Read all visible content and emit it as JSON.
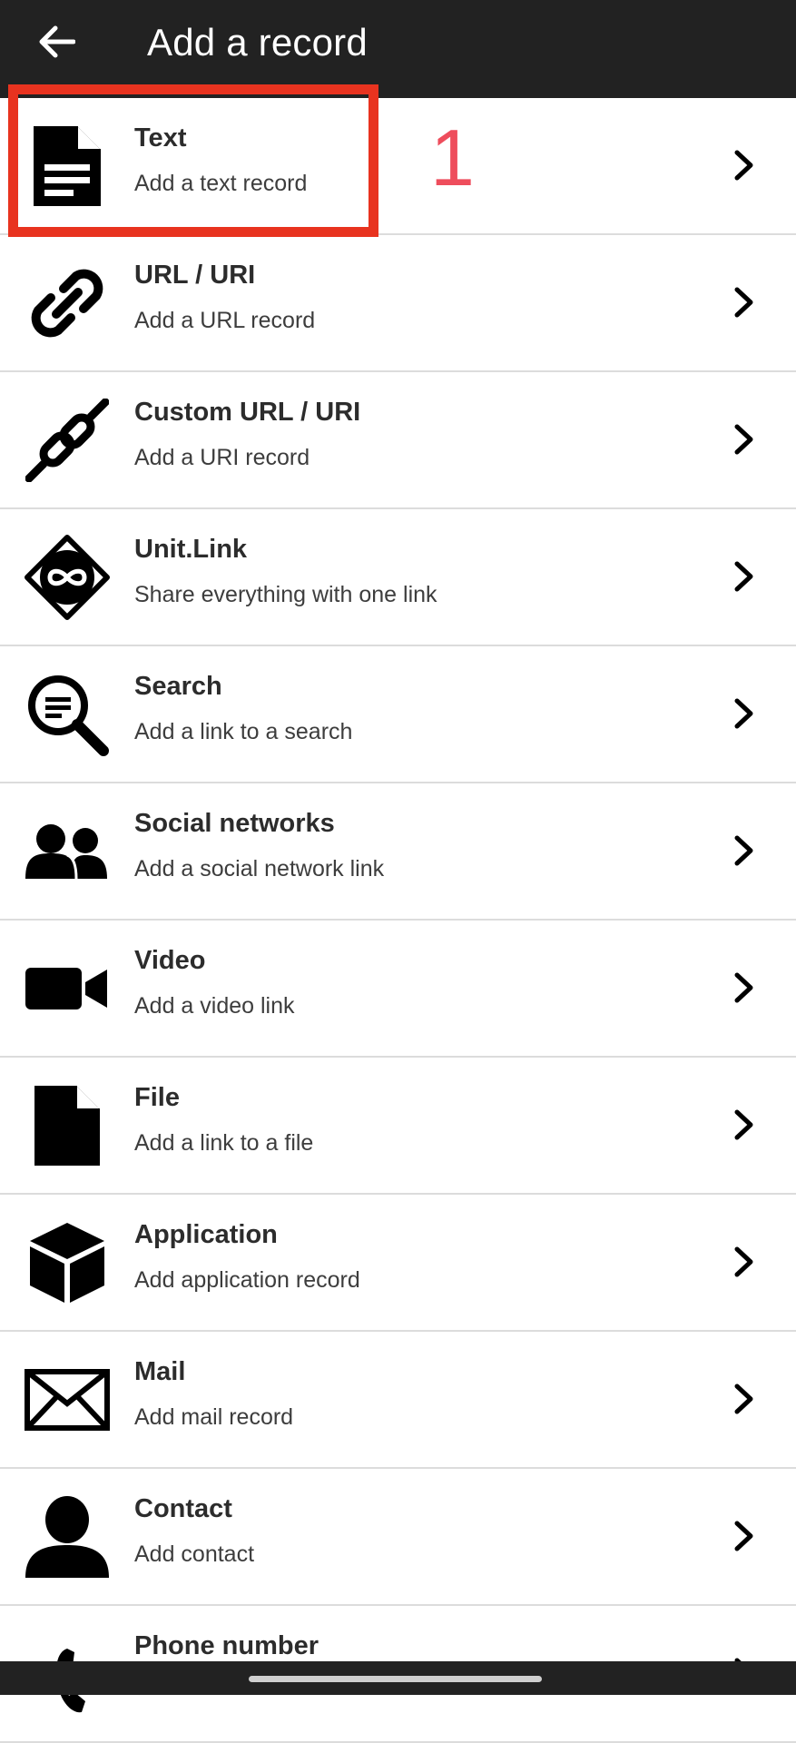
{
  "header": {
    "title": "Add a record",
    "back_icon": "arrow-left-icon"
  },
  "items": [
    {
      "id": "text",
      "title": "Text",
      "subtitle": "Add a text record",
      "icon": "document-icon"
    },
    {
      "id": "url",
      "title": "URL / URI",
      "subtitle": "Add a URL record",
      "icon": "link-icon"
    },
    {
      "id": "custom-url",
      "title": "Custom URL / URI",
      "subtitle": "Add a URI record",
      "icon": "chain-link-icon"
    },
    {
      "id": "unit-link",
      "title": "Unit.Link",
      "subtitle": "Share everything with one link",
      "icon": "infinity-badge-icon"
    },
    {
      "id": "search",
      "title": "Search",
      "subtitle": "Add a link to a search",
      "icon": "magnifier-icon"
    },
    {
      "id": "social",
      "title": "Social networks",
      "subtitle": "Add a social network link",
      "icon": "people-icon"
    },
    {
      "id": "video",
      "title": "Video",
      "subtitle": "Add a video link",
      "icon": "video-camera-icon"
    },
    {
      "id": "file",
      "title": "File",
      "subtitle": "Add a link to a file",
      "icon": "file-icon"
    },
    {
      "id": "application",
      "title": "Application",
      "subtitle": "Add application record",
      "icon": "cube-icon"
    },
    {
      "id": "mail",
      "title": "Mail",
      "subtitle": "Add mail record",
      "icon": "envelope-icon"
    },
    {
      "id": "contact",
      "title": "Contact",
      "subtitle": "Add contact",
      "icon": "person-icon"
    },
    {
      "id": "phone",
      "title": "Phone number",
      "subtitle": "",
      "icon": "phone-icon"
    }
  ],
  "annotation": {
    "step_number": "1",
    "color": "#e8331f",
    "number_color": "#ee4d5c"
  },
  "colors": {
    "appbar": "#222222",
    "divider": "#dcdcdc",
    "title_text": "#2c2c2c"
  }
}
